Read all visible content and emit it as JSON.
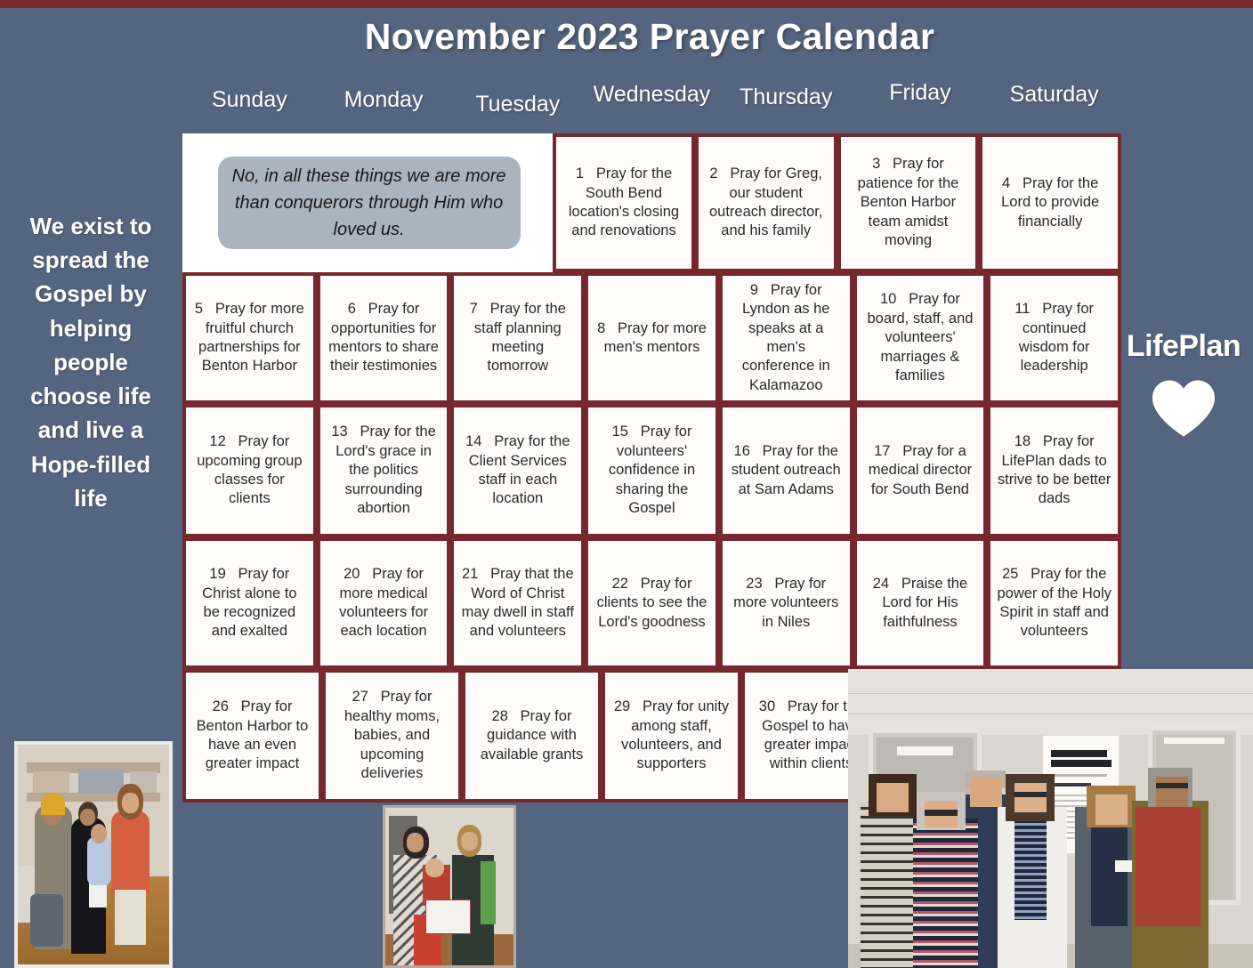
{
  "header": {
    "title": "November 2023 Prayer Calendar"
  },
  "weekdays": [
    "Sunday",
    "Monday",
    "Tuesday",
    "Wednesday",
    "Thursday",
    "Friday",
    "Saturday"
  ],
  "verse": {
    "text": "No, in all these things we are more than conquerors through Him who loved us."
  },
  "mission": {
    "text": "We exist to spread the Gospel by helping people choose life and live a Hope-filled life"
  },
  "brand": {
    "name": "LifePlan",
    "heart_icon": "heart-icon"
  },
  "days": [
    {
      "num": "1",
      "text": "Pray for the South Bend location's closing and renovations"
    },
    {
      "num": "2",
      "text": "Pray for Greg, our student outreach director, and his family"
    },
    {
      "num": "3",
      "text": "Pray for patience for the Benton Harbor team amidst moving"
    },
    {
      "num": "4",
      "text": "Pray for the Lord to provide financially"
    },
    {
      "num": "5",
      "text": "Pray for more fruitful church partnerships for Benton Harbor"
    },
    {
      "num": "6",
      "text": "Pray for opportunities for mentors to share their testimonies"
    },
    {
      "num": "7",
      "text": "Pray for the staff planning meeting tomorrow"
    },
    {
      "num": "8",
      "text": "Pray for more men's mentors"
    },
    {
      "num": "9",
      "text": "Pray for Lyndon as he speaks at a men's conference in Kalamazoo"
    },
    {
      "num": "10",
      "text": "Pray for board, staff, and volunteers' marriages & families"
    },
    {
      "num": "11",
      "text": "Pray for continued wisdom for leadership"
    },
    {
      "num": "12",
      "text": "Pray for upcoming group classes for clients"
    },
    {
      "num": "13",
      "text": "Pray for the Lord's grace in the politics surrounding abortion"
    },
    {
      "num": "14",
      "text": "Pray  for the Client Services staff in each location"
    },
    {
      "num": "15",
      "text": "Pray for volunteers' confidence in sharing the Gospel"
    },
    {
      "num": "16",
      "text": "Pray for the student outreach at Sam Adams"
    },
    {
      "num": "17",
      "text": "Pray for a medical director for South Bend"
    },
    {
      "num": "18",
      "text": "Pray for LifePlan dads to strive to be better dads"
    },
    {
      "num": "19",
      "text": "Pray for Christ alone to be recognized and exalted"
    },
    {
      "num": "20",
      "text": "Pray for more medical volunteers for each location"
    },
    {
      "num": "21",
      "text": "Pray that the Word of Christ may dwell in staff and volunteers"
    },
    {
      "num": "22",
      "text": "Pray for clients to see the Lord's goodness"
    },
    {
      "num": "23",
      "text": "Pray for more volunteers in Niles"
    },
    {
      "num": "24",
      "text": "Praise the Lord for His faithfulness"
    },
    {
      "num": "25",
      "text": "Pray for the power of the Holy Spirit in staff and volunteers"
    },
    {
      "num": "26",
      "text": "Pray for Benton Harbor to have an even greater impact"
    },
    {
      "num": "27",
      "text": "Pray for healthy moms, babies, and upcoming deliveries"
    },
    {
      "num": "28",
      "text": "Pray for guidance with available grants"
    },
    {
      "num": "29",
      "text": "Pray for unity among staff, volunteers, and supporters"
    },
    {
      "num": "30",
      "text": "Pray for the Gospel to have greater impact within clients"
    }
  ],
  "photos": [
    {
      "name": "photo-family-store",
      "caption": "Family with baby in store with LifePlan staff member"
    },
    {
      "name": "photo-certificate",
      "caption": "Client with baby holding certificate beside LifePlan staff member"
    },
    {
      "name": "photo-team-group",
      "caption": "Six LifePlan team members in front of LifePlan Benton Harbor prayer poster"
    }
  ],
  "colors": {
    "background": "#54657f",
    "accent_stripe": "#7b2b30",
    "cell_border": "#77282d",
    "cell_fill": "#fdfcfb",
    "verse_bubble": "#aab4bf",
    "text_light": "#ffffff"
  }
}
